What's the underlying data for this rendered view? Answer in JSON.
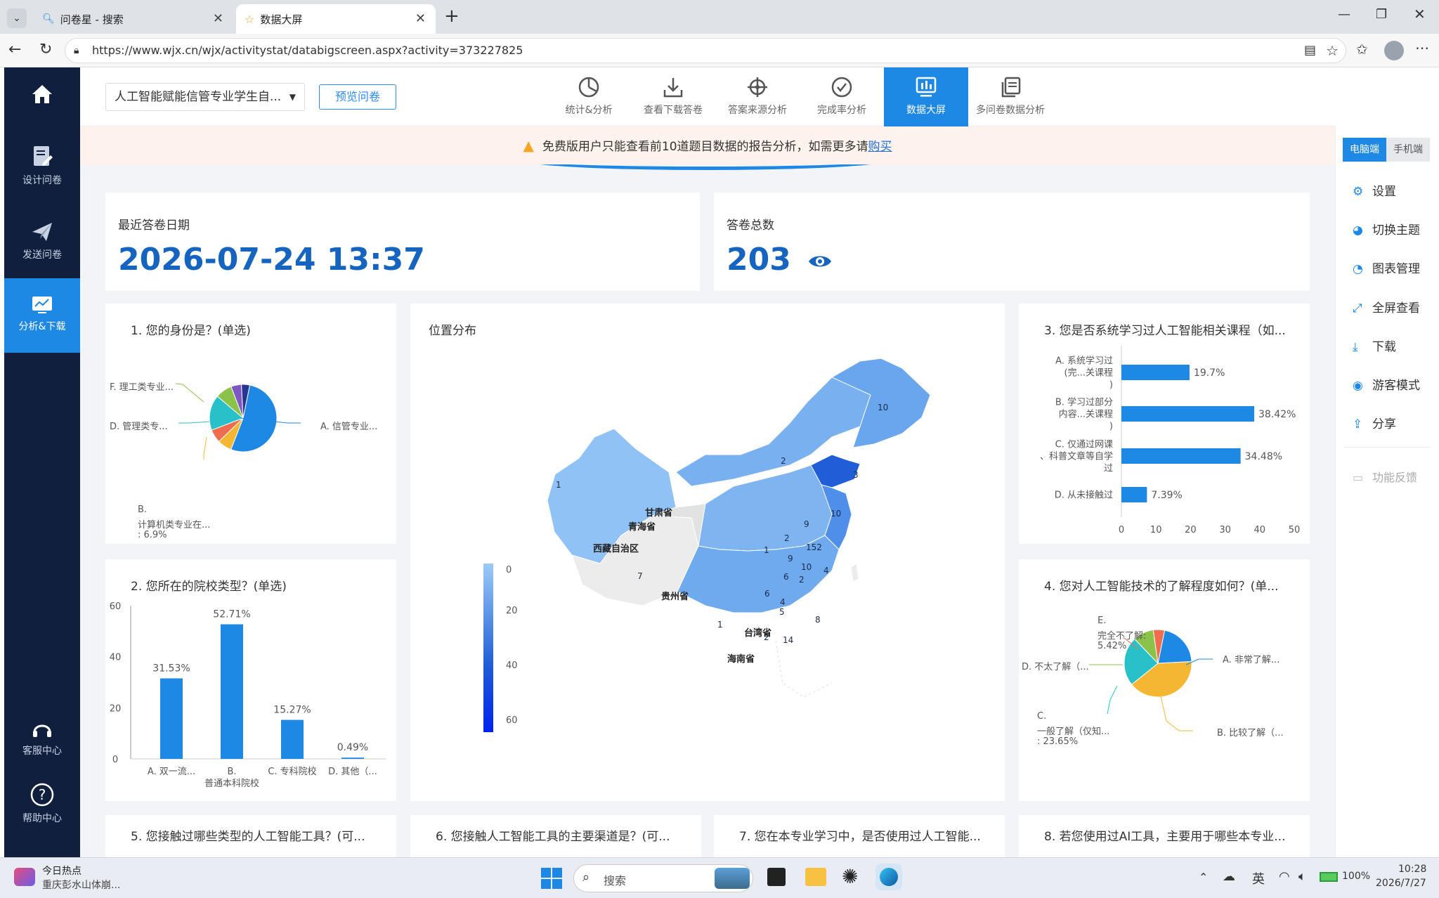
{
  "browser": {
    "tabs": [
      {
        "title": "问卷星 - 搜索",
        "icon": "search-icon"
      },
      {
        "title": "数据大屏",
        "icon": "star-icon"
      }
    ],
    "url": "https://www.wjx.cn/wjx/activitystat/databigscreen.aspx?activity=373227825"
  },
  "sidebar": {
    "items": [
      {
        "label": "",
        "icon": "home-icon"
      },
      {
        "label": "设计问卷",
        "icon": "edit-icon"
      },
      {
        "label": "发送问卷",
        "icon": "send-icon"
      },
      {
        "label": "分析&下载",
        "icon": "chart-icon",
        "active": true
      },
      {
        "label": "客服中心",
        "icon": "headset-icon"
      },
      {
        "label": "帮助中心",
        "icon": "help-icon"
      }
    ]
  },
  "toolbar": {
    "survey_select": "人工智能赋能信管专业学生自...",
    "preview_label": "预览问卷",
    "tabs": [
      {
        "label": "统计&分析",
        "icon": "pie-icon"
      },
      {
        "label": "查看下载答卷",
        "icon": "download-icon"
      },
      {
        "label": "答案来源分析",
        "icon": "crosshair-icon"
      },
      {
        "label": "完成率分析",
        "icon": "check-circle-icon"
      },
      {
        "label": "数据大屏",
        "icon": "screen-icon",
        "active": true
      },
      {
        "label": "多问卷数据分析",
        "icon": "copy-icon"
      }
    ]
  },
  "notice": {
    "text": "免费版用户只能查看前10道题目数据的报告分析，如需更多请",
    "link": "购买"
  },
  "right_panel": {
    "view_tabs": [
      "电脑端",
      "手机端"
    ],
    "items": [
      {
        "label": "设置",
        "icon": "gear-icon"
      },
      {
        "label": "切换主题",
        "icon": "palette-icon"
      },
      {
        "label": "图表管理",
        "icon": "chart-pie-icon"
      },
      {
        "label": "全屏查看",
        "icon": "fullscreen-icon"
      },
      {
        "label": "下载",
        "icon": "download-icon"
      },
      {
        "label": "游客模式",
        "icon": "eye-icon"
      },
      {
        "label": "分享",
        "icon": "share-icon"
      },
      {
        "label": "功能反馈",
        "icon": "feedback-icon"
      }
    ]
  },
  "stats": {
    "last_date_label": "最近答卷日期",
    "last_date": "2026-07-24 13:37",
    "total_label": "答卷总数",
    "total": "203"
  },
  "q1": {
    "title": "1. 您的身份是？(单选)",
    "labels": {
      "a": "A. 信管专业...",
      "b1": "B.",
      "b2": "计算机类专业在...",
      "b3": ": 6.9%",
      "d": "D. 管理类专...",
      "f": "F. 理工类专业..."
    },
    "slices": [
      {
        "name": "A. 信管专业...",
        "value": 52.7,
        "color": "#1e88e5"
      },
      {
        "name": "B. 计算机类专业在...",
        "value": 6.9,
        "color": "#f5b731"
      },
      {
        "name": "C",
        "value": 6.4,
        "color": "#ef6c50"
      },
      {
        "name": "D. 管理类专...",
        "value": 17.0,
        "color": "#29c1c9"
      },
      {
        "name": "E",
        "value": 8.0,
        "color": "#8bc34a"
      },
      {
        "name": "F. 理工类专业...",
        "value": 5.0,
        "color": "#7e57c2"
      },
      {
        "name": "G",
        "value": 4.0,
        "color": "#283593"
      }
    ]
  },
  "map": {
    "title": "位置分布",
    "legend_ticks": [
      "0",
      "20",
      "40",
      "60"
    ],
    "labels": [
      {
        "t": "10"
      },
      {
        "t": "2"
      },
      {
        "t": "3"
      },
      {
        "t": "1"
      },
      {
        "t": "10"
      },
      {
        "t": "甘肃省"
      },
      {
        "t": "9"
      },
      {
        "t": "2"
      },
      {
        "t": "青海省"
      },
      {
        "t": "1"
      },
      {
        "t": "152"
      },
      {
        "t": "9"
      },
      {
        "t": "西藏自治区"
      },
      {
        "t": "10"
      },
      {
        "t": "4"
      },
      {
        "t": "7"
      },
      {
        "t": "6"
      },
      {
        "t": "2"
      },
      {
        "t": "6"
      },
      {
        "t": "贵州省"
      },
      {
        "t": "5"
      },
      {
        "t": "4"
      },
      {
        "t": "8"
      },
      {
        "t": "1"
      },
      {
        "t": "2"
      },
      {
        "t": "台湾省"
      },
      {
        "t": "14"
      },
      {
        "t": "海南省"
      }
    ]
  },
  "q3": {
    "title": "3. 您是否系统学习过人工智能相关课程（如...",
    "chart_data": {
      "type": "bar",
      "categories": [
        [
          "A. 系统学习过",
          "(完...关课程",
          ")"
        ],
        [
          "B. 学习过部分",
          "内容...关课程",
          ")"
        ],
        [
          "C. 仅通过网课",
          "、科普文章等自学",
          "过"
        ],
        [
          "D. 从未接触过"
        ]
      ],
      "values": [
        19.7,
        38.42,
        34.48,
        7.39
      ],
      "value_labels": [
        "19.7%",
        "38.42%",
        "34.48%",
        "7.39%"
      ],
      "xticks": [
        "0",
        "10",
        "20",
        "30",
        "40",
        "50"
      ],
      "xlim": [
        0,
        50
      ]
    }
  },
  "q2": {
    "title": "2. 您所在的院校类型？(单选)",
    "chart_data": {
      "type": "bar",
      "categories": [
        [
          "A. 双一流..."
        ],
        [
          "B.",
          "普通本科院校"
        ],
        [
          "C. 专科院校"
        ],
        [
          "D. 其他（..."
        ]
      ],
      "values": [
        31.53,
        52.71,
        15.27,
        0.49
      ],
      "value_labels": [
        "31.53%",
        "52.71%",
        "15.27%",
        "0.49%"
      ],
      "yticks": [
        "60",
        "40",
        "20",
        "0"
      ],
      "ylim": [
        0,
        60
      ]
    }
  },
  "q4": {
    "title": "4. 您对人工智能技术的了解程度如何？(单...",
    "labels": {
      "a": "A. 非常了解...",
      "b": "B. 比较了解（...",
      "c1": "C.",
      "c2": "一般了解（仅知...",
      "c3": ": 23.65%",
      "d": "D. 不太了解（...",
      "e1": "E.",
      "e2": "完全不了解:",
      "e3": "5.42%"
    },
    "slices": [
      {
        "name": "A. 非常了解...",
        "value": 21.0,
        "color": "#1e88e5"
      },
      {
        "name": "B. 比较了解（...",
        "value": 40.0,
        "color": "#f5b731"
      },
      {
        "name": "C. 一般了解（仅知...",
        "value": 23.65,
        "color": "#29c1c9"
      },
      {
        "name": "D. 不太了解（...",
        "value": 9.93,
        "color": "#8bc34a"
      },
      {
        "name": "E. 完全不了解",
        "value": 5.42,
        "color": "#ef6c50"
      }
    ]
  },
  "bottom_titles": [
    "5. 您接触过哪些类型的人工智能工具？(可...",
    "6. 您接触人工智能工具的主要渠道是？(可...",
    "7. 您在本专业学习中，是否使用过人工智能...",
    "8. 若您使用过AI工具，主要用于哪些本专业..."
  ],
  "taskbar": {
    "news_title": "今日热点",
    "news_sub": "重庆彭水山体崩...",
    "search_placeholder": "搜索",
    "lang": "英",
    "battery": "100%",
    "time": "10:28",
    "date": "2026/7/27"
  }
}
